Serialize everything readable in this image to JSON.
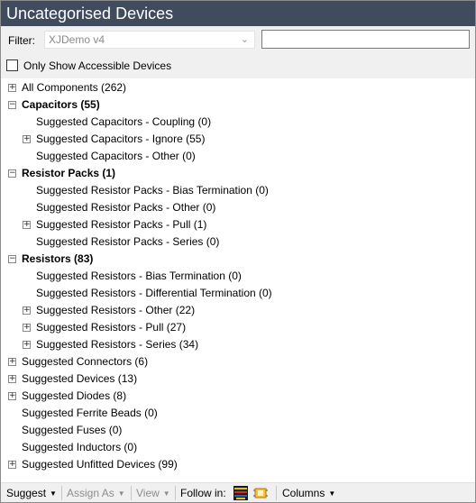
{
  "window": {
    "title": "Uncategorised Devices"
  },
  "filter": {
    "label": "Filter:",
    "selected": "XJDemo v4",
    "search_value": ""
  },
  "accessible_checkbox": {
    "label": "Only Show Accessible Devices",
    "checked": false
  },
  "tree": [
    {
      "text": "All Components (262)",
      "level": 0,
      "expander": "plus",
      "bold": false
    },
    {
      "text": "Capacitors (55)",
      "level": 0,
      "expander": "minus",
      "bold": true
    },
    {
      "text": "Suggested Capacitors - Coupling (0)",
      "level": 1,
      "expander": "none",
      "bold": false
    },
    {
      "text": "Suggested Capacitors - Ignore (55)",
      "level": 1,
      "expander": "plus",
      "bold": false
    },
    {
      "text": "Suggested Capacitors - Other (0)",
      "level": 1,
      "expander": "none",
      "bold": false
    },
    {
      "text": "Resistor Packs (1)",
      "level": 0,
      "expander": "minus",
      "bold": true
    },
    {
      "text": "Suggested Resistor Packs - Bias Termination (0)",
      "level": 1,
      "expander": "none",
      "bold": false
    },
    {
      "text": "Suggested Resistor Packs - Other (0)",
      "level": 1,
      "expander": "none",
      "bold": false
    },
    {
      "text": "Suggested Resistor Packs - Pull (1)",
      "level": 1,
      "expander": "plus",
      "bold": false
    },
    {
      "text": "Suggested Resistor Packs - Series (0)",
      "level": 1,
      "expander": "none",
      "bold": false
    },
    {
      "text": "Resistors (83)",
      "level": 0,
      "expander": "minus",
      "bold": true
    },
    {
      "text": "Suggested Resistors - Bias Termination (0)",
      "level": 1,
      "expander": "none",
      "bold": false
    },
    {
      "text": "Suggested Resistors - Differential Termination (0)",
      "level": 1,
      "expander": "none",
      "bold": false
    },
    {
      "text": "Suggested Resistors - Other (22)",
      "level": 1,
      "expander": "plus",
      "bold": false
    },
    {
      "text": "Suggested Resistors - Pull (27)",
      "level": 1,
      "expander": "plus",
      "bold": false
    },
    {
      "text": "Suggested Resistors - Series (34)",
      "level": 1,
      "expander": "plus",
      "bold": false
    },
    {
      "text": "Suggested Connectors (6)",
      "level": 0,
      "expander": "plus",
      "bold": false
    },
    {
      "text": "Suggested Devices (13)",
      "level": 0,
      "expander": "plus",
      "bold": false
    },
    {
      "text": "Suggested Diodes (8)",
      "level": 0,
      "expander": "plus",
      "bold": false
    },
    {
      "text": "Suggested Ferrite Beads (0)",
      "level": 0,
      "expander": "none",
      "bold": false
    },
    {
      "text": "Suggested Fuses (0)",
      "level": 0,
      "expander": "none",
      "bold": false
    },
    {
      "text": "Suggested Inductors (0)",
      "level": 0,
      "expander": "none",
      "bold": false
    },
    {
      "text": "Suggested Unfitted Devices (99)",
      "level": 0,
      "expander": "plus",
      "bold": false
    }
  ],
  "toolbar": {
    "suggest": "Suggest",
    "assign_as": "Assign As",
    "view": "View",
    "follow_in": "Follow in:",
    "follow_icons": [
      "layout-view-icon",
      "schematic-view-icon"
    ],
    "columns": "Columns"
  },
  "colors": {
    "titlebar": "#404c5e",
    "panel": "#f0f0f0",
    "disabled_text": "#8d8d8d"
  }
}
